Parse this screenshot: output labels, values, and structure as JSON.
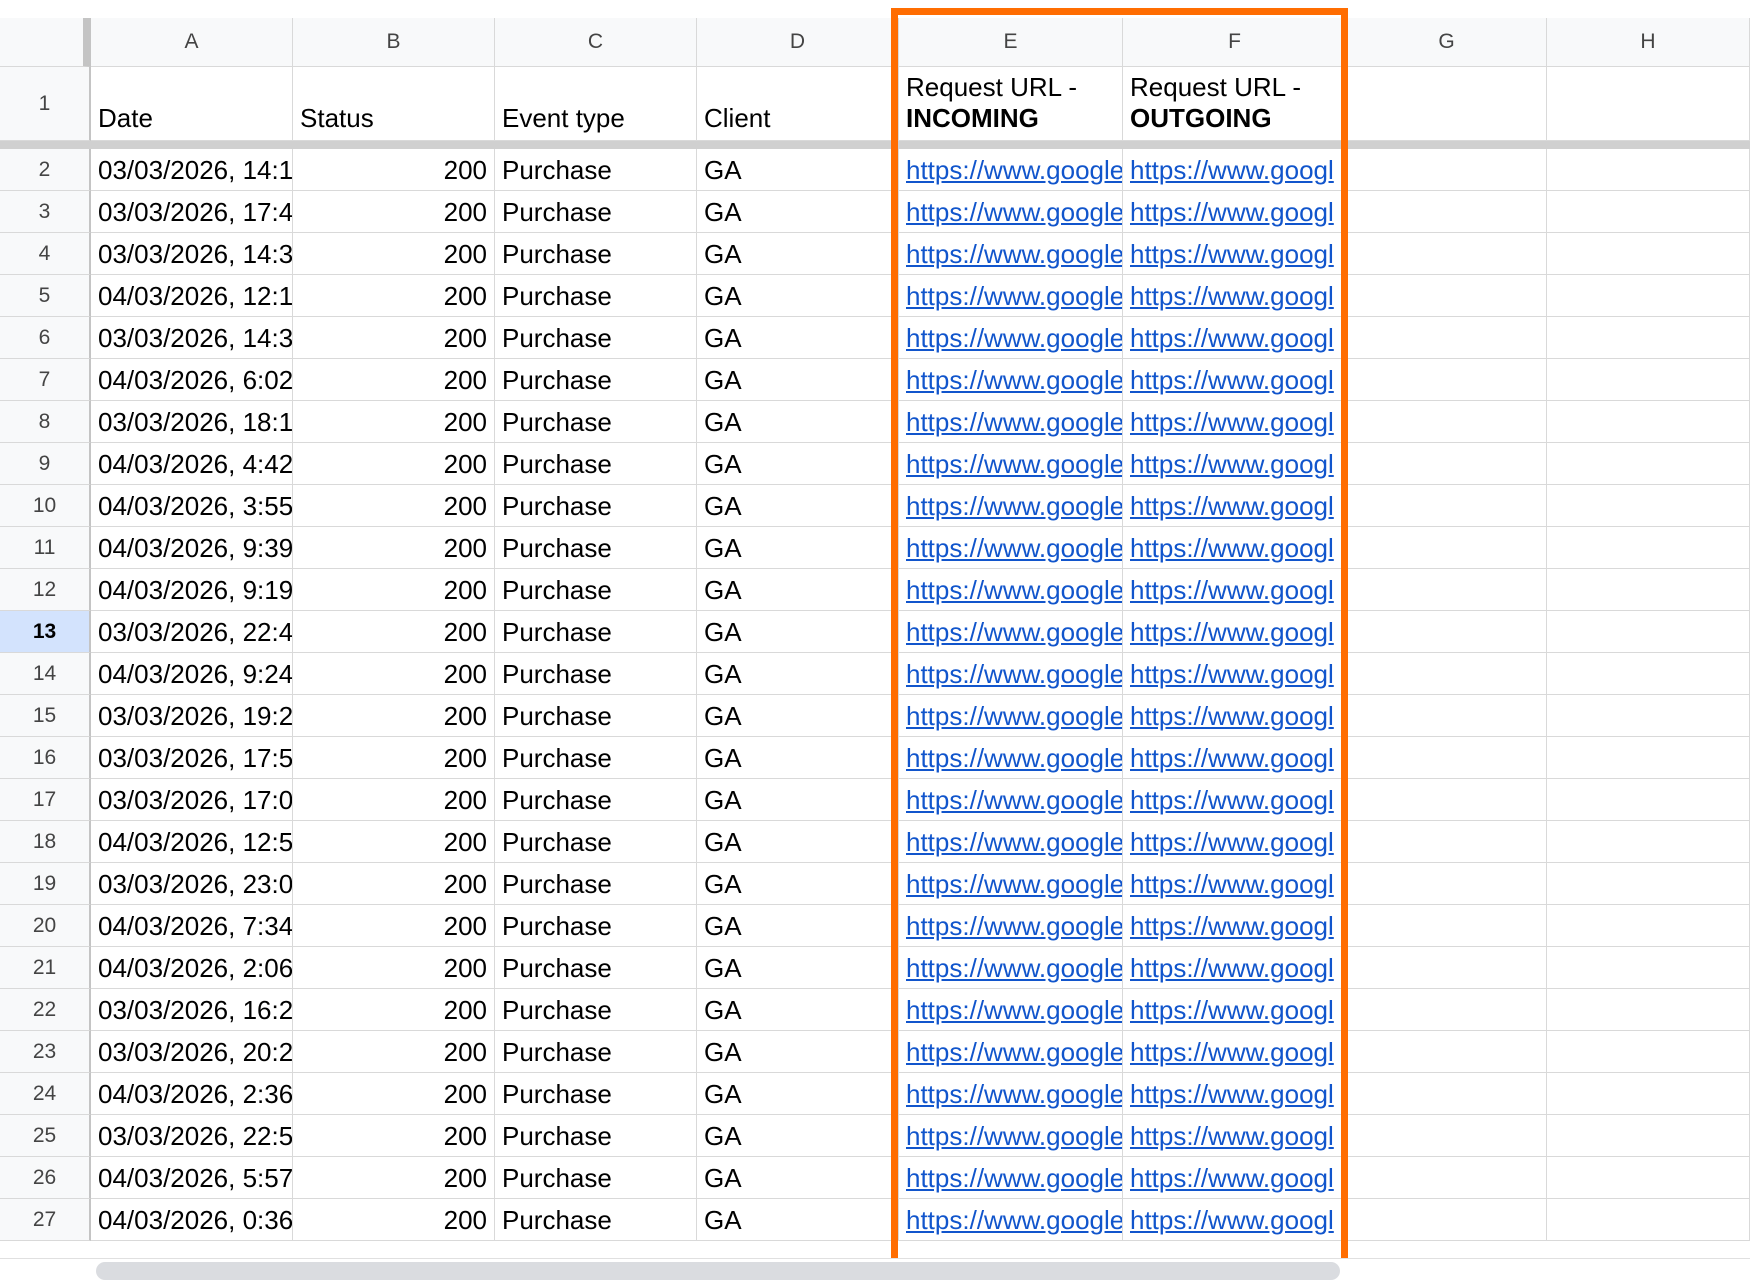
{
  "columns": [
    "A",
    "B",
    "C",
    "D",
    "E",
    "F",
    "G",
    "H"
  ],
  "header_row": {
    "number": "1",
    "date": "Date",
    "status": "Status",
    "event_type": "Event type",
    "client": "Client",
    "incoming_prefix": "Request URL -",
    "incoming_bold": "INCOMING",
    "outgoing_prefix": "Request URL -",
    "outgoing_bold": "OUTGOING"
  },
  "active_row": "13",
  "highlight_color": "#ff6d01",
  "link_color": "#1155cc",
  "rows": [
    {
      "n": "2",
      "date": "03/03/2026, 14:1",
      "status": "200",
      "event": "Purchase",
      "client": "GA",
      "in": "https://www.google",
      "out": "https://www.googl"
    },
    {
      "n": "3",
      "date": "03/03/2026, 17:4",
      "status": "200",
      "event": "Purchase",
      "client": "GA",
      "in": "https://www.google",
      "out": "https://www.googl"
    },
    {
      "n": "4",
      "date": "03/03/2026, 14:3",
      "status": "200",
      "event": "Purchase",
      "client": "GA",
      "in": "https://www.google",
      "out": "https://www.googl"
    },
    {
      "n": "5",
      "date": "04/03/2026, 12:1",
      "status": "200",
      "event": "Purchase",
      "client": "GA",
      "in": "https://www.google",
      "out": "https://www.googl"
    },
    {
      "n": "6",
      "date": "03/03/2026, 14:3",
      "status": "200",
      "event": "Purchase",
      "client": "GA",
      "in": "https://www.google",
      "out": "https://www.googl"
    },
    {
      "n": "7",
      "date": "04/03/2026, 6:02",
      "status": "200",
      "event": "Purchase",
      "client": "GA",
      "in": "https://www.google",
      "out": "https://www.googl"
    },
    {
      "n": "8",
      "date": "03/03/2026, 18:1",
      "status": "200",
      "event": "Purchase",
      "client": "GA",
      "in": "https://www.google",
      "out": "https://www.googl"
    },
    {
      "n": "9",
      "date": "04/03/2026, 4:42",
      "status": "200",
      "event": "Purchase",
      "client": "GA",
      "in": "https://www.google",
      "out": "https://www.googl"
    },
    {
      "n": "10",
      "date": "04/03/2026, 3:55",
      "status": "200",
      "event": "Purchase",
      "client": "GA",
      "in": "https://www.google",
      "out": "https://www.googl"
    },
    {
      "n": "11",
      "date": "04/03/2026, 9:39",
      "status": "200",
      "event": "Purchase",
      "client": "GA",
      "in": "https://www.google",
      "out": "https://www.googl"
    },
    {
      "n": "12",
      "date": "04/03/2026, 9:19",
      "status": "200",
      "event": "Purchase",
      "client": "GA",
      "in": "https://www.google",
      "out": "https://www.googl"
    },
    {
      "n": "13",
      "date": "03/03/2026, 22:4",
      "status": "200",
      "event": "Purchase",
      "client": "GA",
      "in": "https://www.google",
      "out": "https://www.googl"
    },
    {
      "n": "14",
      "date": "04/03/2026, 9:24",
      "status": "200",
      "event": "Purchase",
      "client": "GA",
      "in": "https://www.google",
      "out": "https://www.googl"
    },
    {
      "n": "15",
      "date": "03/03/2026, 19:2",
      "status": "200",
      "event": "Purchase",
      "client": "GA",
      "in": "https://www.google",
      "out": "https://www.googl"
    },
    {
      "n": "16",
      "date": "03/03/2026, 17:5",
      "status": "200",
      "event": "Purchase",
      "client": "GA",
      "in": "https://www.google",
      "out": "https://www.googl"
    },
    {
      "n": "17",
      "date": "03/03/2026, 17:0",
      "status": "200",
      "event": "Purchase",
      "client": "GA",
      "in": "https://www.google",
      "out": "https://www.googl"
    },
    {
      "n": "18",
      "date": "04/03/2026, 12:5",
      "status": "200",
      "event": "Purchase",
      "client": "GA",
      "in": "https://www.google",
      "out": "https://www.googl"
    },
    {
      "n": "19",
      "date": "03/03/2026, 23:0",
      "status": "200",
      "event": "Purchase",
      "client": "GA",
      "in": "https://www.google",
      "out": "https://www.googl"
    },
    {
      "n": "20",
      "date": "04/03/2026, 7:34",
      "status": "200",
      "event": "Purchase",
      "client": "GA",
      "in": "https://www.google",
      "out": "https://www.googl"
    },
    {
      "n": "21",
      "date": "04/03/2026, 2:06",
      "status": "200",
      "event": "Purchase",
      "client": "GA",
      "in": "https://www.google",
      "out": "https://www.googl"
    },
    {
      "n": "22",
      "date": "03/03/2026, 16:2",
      "status": "200",
      "event": "Purchase",
      "client": "GA",
      "in": "https://www.google",
      "out": "https://www.googl"
    },
    {
      "n": "23",
      "date": "03/03/2026, 20:2",
      "status": "200",
      "event": "Purchase",
      "client": "GA",
      "in": "https://www.google",
      "out": "https://www.googl"
    },
    {
      "n": "24",
      "date": "04/03/2026, 2:36",
      "status": "200",
      "event": "Purchase",
      "client": "GA",
      "in": "https://www.google",
      "out": "https://www.googl"
    },
    {
      "n": "25",
      "date": "03/03/2026, 22:5",
      "status": "200",
      "event": "Purchase",
      "client": "GA",
      "in": "https://www.google",
      "out": "https://www.googl"
    },
    {
      "n": "26",
      "date": "04/03/2026, 5:57",
      "status": "200",
      "event": "Purchase",
      "client": "GA",
      "in": "https://www.google",
      "out": "https://www.googl"
    },
    {
      "n": "27",
      "date": "04/03/2026, 0:36",
      "status": "200",
      "event": "Purchase",
      "client": "GA",
      "in": "https://www.google",
      "out": "https://www.googl"
    }
  ]
}
